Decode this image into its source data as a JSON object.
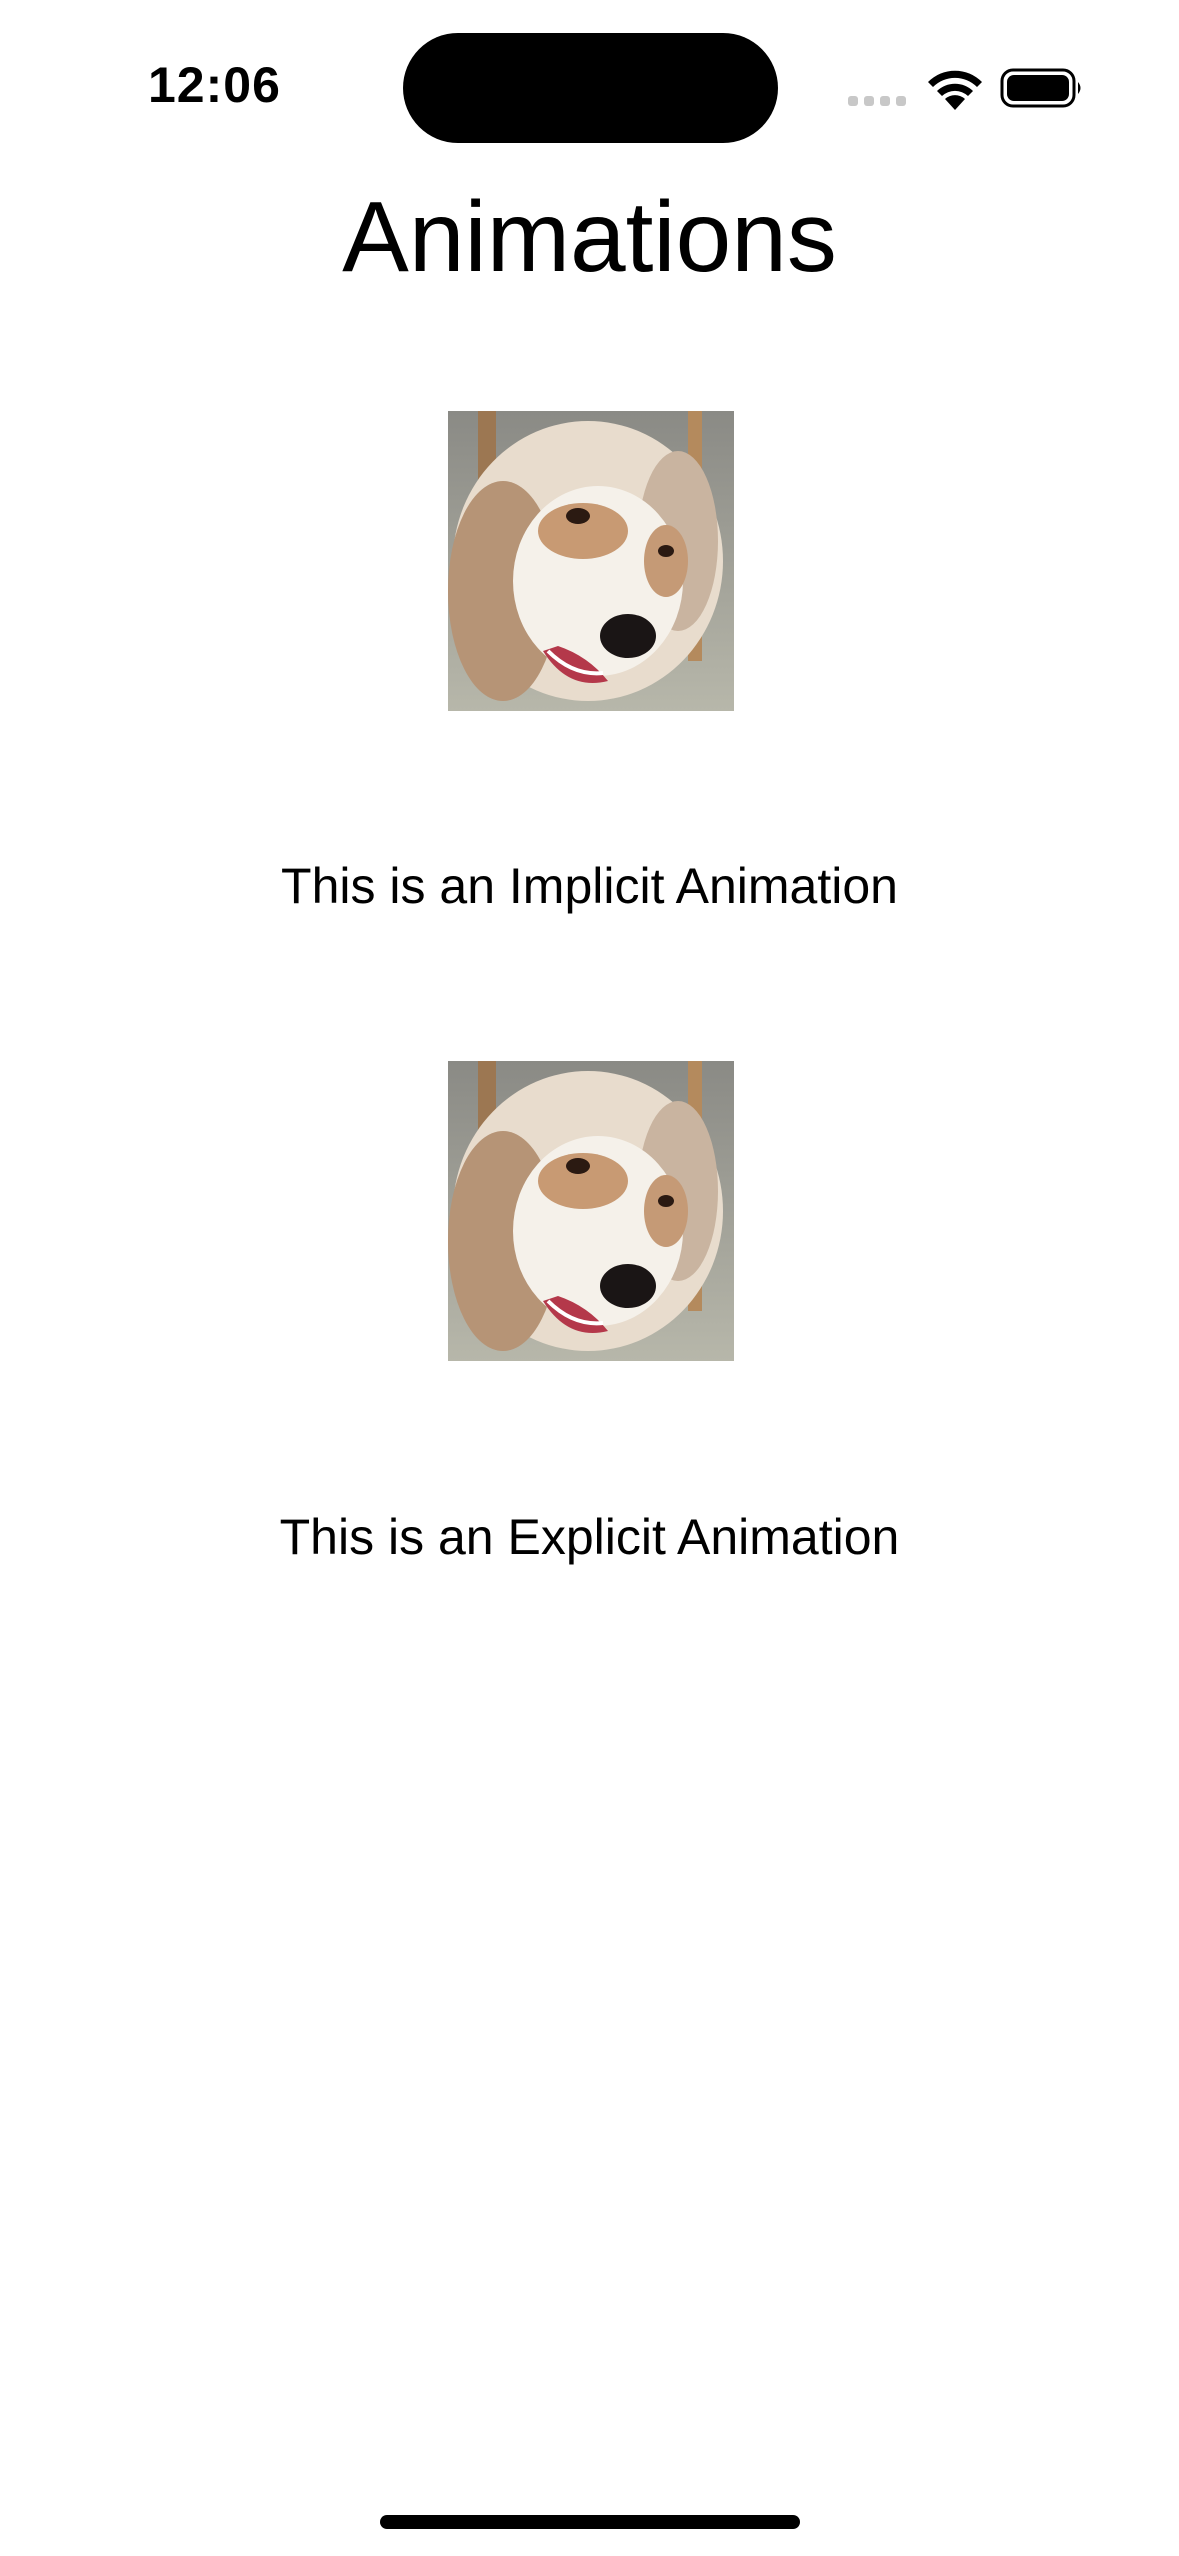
{
  "status_bar": {
    "time": "12:06"
  },
  "screen": {
    "title": "Animations",
    "implicit_caption": "This is an Implicit Animation",
    "explicit_caption": "This is an Explicit Animation"
  },
  "icons": {
    "wifi": "wifi-icon",
    "battery": "battery-icon",
    "signal": "signal-dots-icon"
  }
}
